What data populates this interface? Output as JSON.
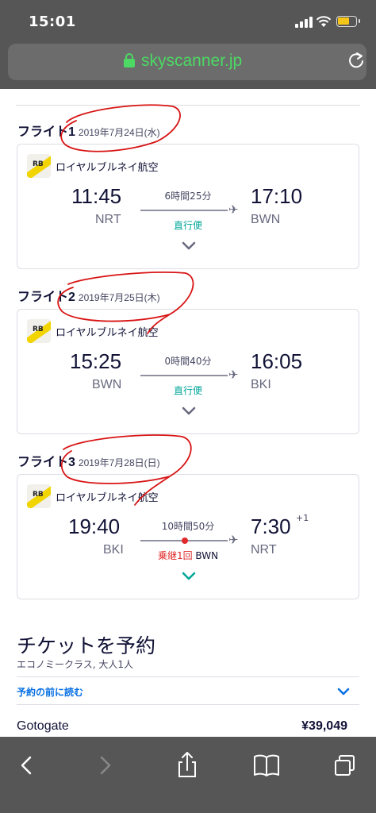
{
  "status_bar": {
    "time": "15:01"
  },
  "browser": {
    "url": "skyscanner.jp"
  },
  "colors": {
    "accent": "#0770e3",
    "direct": "#00a698",
    "stop": "#e02a2a",
    "chrome": "#565656",
    "url_green": "#4cd964"
  },
  "flights": [
    {
      "title": "フライト1",
      "date": "2019年7月24日(水)",
      "airline": "ロイヤルブルネイ航空",
      "logo_text": "RB",
      "depart_time": "11:45",
      "depart_code": "NRT",
      "arrive_time": "17:10",
      "arrive_code": "BWN",
      "duration": "6時間25分",
      "stop_label": "直行便"
    },
    {
      "title": "フライト2",
      "date": "2019年7月25日(木)",
      "airline": "ロイヤルブルネイ航空",
      "logo_text": "RB",
      "depart_time": "15:25",
      "depart_code": "BWN",
      "arrive_time": "16:05",
      "arrive_code": "BKI",
      "duration": "0時間40分",
      "stop_label": "直行便"
    },
    {
      "title": "フライト3",
      "date": "2019年7月28日(日)",
      "airline": "ロイヤルブルネイ航空",
      "logo_text": "RB",
      "depart_time": "19:40",
      "depart_code": "BKI",
      "arrive_time": "7:30",
      "arrive_day_offset": "+1",
      "arrive_code": "NRT",
      "duration": "10時間50分",
      "stop_label": "乗継1回",
      "stop_airport": "BWN"
    }
  ],
  "ticket": {
    "title": "チケットを予約",
    "subtitle": "エコノミークラス, 大人1人",
    "read_before": "予約の前に読む",
    "provider": "Gotogate",
    "price": "¥39,049"
  },
  "icons": {
    "back": "chevron-left-icon",
    "forward": "chevron-right-icon",
    "share": "share-icon",
    "bookmarks": "book-icon",
    "tabs": "tabs-icon",
    "reload": "reload-icon",
    "lock": "lock-icon"
  }
}
